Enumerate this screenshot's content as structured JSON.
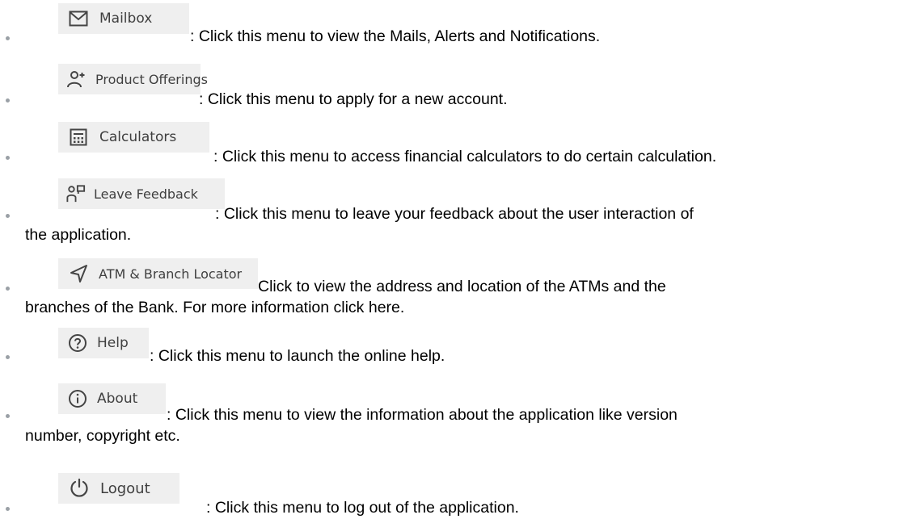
{
  "items": [
    {
      "key": "mailbox",
      "label": "Mailbox",
      "icon": "envelope-icon",
      "desc": ": Click this menu to view the Mails, Alerts and Notifications."
    },
    {
      "key": "product-offerings",
      "label": "Product Offerings",
      "icon": "add-user-icon",
      "desc": ": Click this menu to apply for a new account."
    },
    {
      "key": "calculators",
      "label": "Calculators",
      "icon": "calculator-icon",
      "desc": ": Click this menu to access financial calculators to do certain calculation."
    },
    {
      "key": "leave-feedback",
      "label": "Leave Feedback",
      "icon": "feedback-icon",
      "desc": ": Click this menu to leave your feedback about the user interaction of",
      "desc_cont": "the application."
    },
    {
      "key": "atm-branch-locator",
      "label": "ATM & Branch Locator",
      "icon": "navigation-arrow-icon",
      "desc": "Click to view the address and location of the ATMs and the",
      "desc_cont": "branches of the Bank. For more information click here."
    },
    {
      "key": "help",
      "label": "Help",
      "icon": "question-circle-icon",
      "desc": ": Click this menu to launch the online help."
    },
    {
      "key": "about",
      "label": "About",
      "icon": "info-circle-icon",
      "desc": ": Click this menu to view the information about the application like version",
      "desc_cont": "number, copyright etc."
    },
    {
      "key": "logout",
      "label": "Logout",
      "icon": "power-icon",
      "desc": ": Click this menu to log out of the application."
    }
  ],
  "colors": {
    "button_bg": "#efefef",
    "button_text": "#3f3f3f",
    "bullet": "#9aa0a6",
    "text": "#000000"
  }
}
